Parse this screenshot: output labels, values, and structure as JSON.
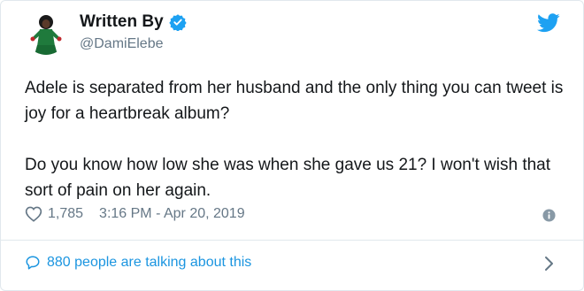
{
  "author": {
    "name": "Written By",
    "handle": "@DamiElebe",
    "verified": true
  },
  "tweet": {
    "paragraphs": [
      "Adele is separated from her husband and the only thing you can tweet is joy for a heartbreak album?",
      "Do you know how low she was when she gave us 21? I won't wish that sort of pain on her again."
    ],
    "likes": "1,785",
    "timestamp": "3:16 PM - Apr 20, 2019"
  },
  "footer": {
    "talking": "880 people are talking about this"
  },
  "icons": {
    "brand": "twitter-bird-icon",
    "verified": "verified-badge-icon",
    "like": "heart-icon",
    "info": "info-icon",
    "reply": "speech-bubble-icon",
    "more": "chevron-right-icon"
  },
  "colors": {
    "accent": "#1da1f2",
    "link": "#1b95e0",
    "muted": "#657786",
    "text": "#14171a",
    "border": "#e1e8ed",
    "avatar_dress": "#1f7a3c"
  }
}
